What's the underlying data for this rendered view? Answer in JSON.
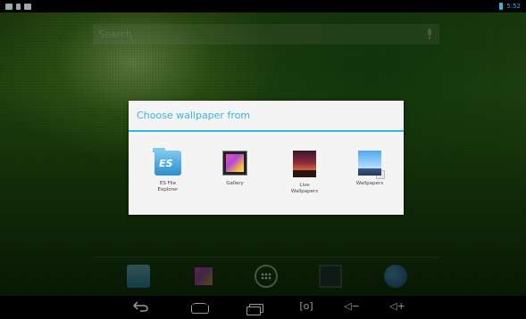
{
  "status_bar": {
    "time": "5:52",
    "left_icons": [
      "image-icon",
      "question-icon",
      "chat-icon"
    ],
    "right_icons": [
      "battery-icon"
    ],
    "accent_color": "#33b5e5"
  },
  "search": {
    "placeholder": "Search",
    "mic_icon": "mic-icon"
  },
  "dialog": {
    "title": "Choose wallpaper from",
    "accent_color": "#33b5e5",
    "options": [
      {
        "label_line1": "ES File",
        "label_line2": "Explorer",
        "icon": "es-file-explorer-icon"
      },
      {
        "label_line1": "Gallery",
        "label_line2": "",
        "icon": "gallery-icon"
      },
      {
        "label_line1": "Live",
        "label_line2": "Wallpapers",
        "icon": "live-wallpapers-icon"
      },
      {
        "label_line1": "Wallpapers",
        "label_line2": "",
        "icon": "wallpapers-icon"
      }
    ]
  },
  "dock": {
    "items": [
      "es-file-explorer-icon",
      "gallery-icon",
      "all-apps-icon",
      "screen-icon",
      "browser-globe-icon"
    ]
  },
  "nav_bar": {
    "buttons": [
      "back-icon",
      "home-icon",
      "recent-apps-icon",
      "screenshot-icon",
      "volume-down-icon",
      "volume-up-icon"
    ],
    "screenshot_glyph": "[o]",
    "volume_down_glyph": "◁−",
    "volume_up_glyph": "◁+"
  }
}
